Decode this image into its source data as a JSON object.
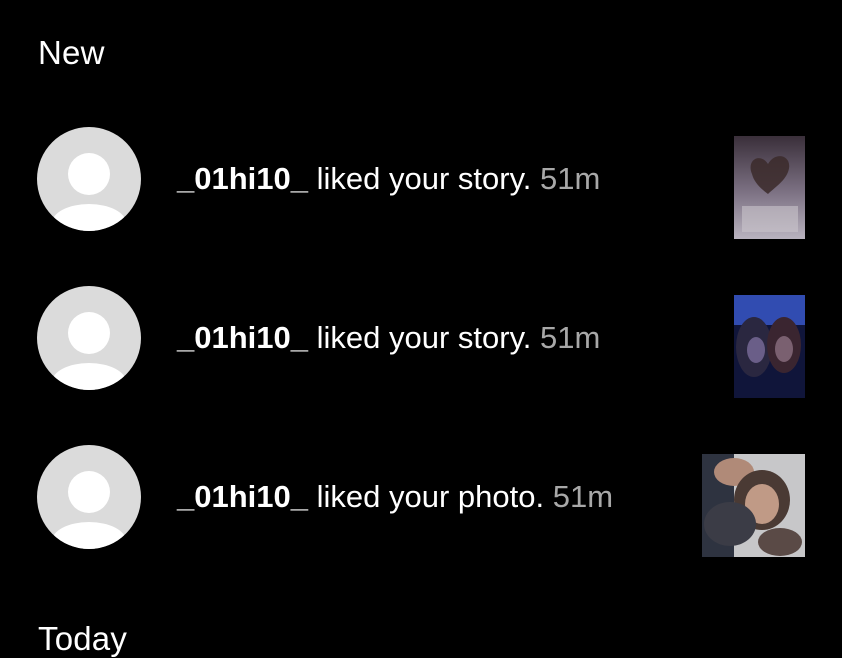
{
  "sections": {
    "new_label": "New",
    "today_label": "Today"
  },
  "notifications": [
    {
      "username": "_01hi10_",
      "action": "liked your story.",
      "time": "51m",
      "thumbnail": "story-thumbnail-heart-hands"
    },
    {
      "username": "_01hi10_",
      "action": "liked your story.",
      "time": "51m",
      "thumbnail": "story-thumbnail-two-people-blue"
    },
    {
      "username": "_01hi10_",
      "action": "liked your photo.",
      "time": "51m",
      "thumbnail": "photo-thumbnail-two-people"
    }
  ],
  "colors": {
    "background": "#000000",
    "text": "#ffffff",
    "timestamp": "#a8a8a8",
    "avatar_bg": "#dbdbdb",
    "avatar_silhouette": "#ffffff"
  }
}
